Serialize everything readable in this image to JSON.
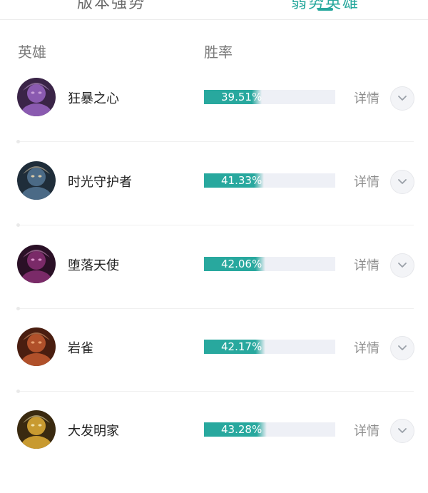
{
  "tabs": [
    {
      "label": "版本强势"
    },
    {
      "label": "弱势英雄"
    }
  ],
  "header": {
    "hero": "英雄",
    "win_rate": "胜率"
  },
  "rows": [
    {
      "name": "狂暴之心",
      "win_rate_text": "39.51%",
      "win_rate": 39.51,
      "detail": "详情",
      "avatar_colors": [
        "#3a2447",
        "#8a5ab0",
        "#c8a0d8"
      ]
    },
    {
      "name": "时光守护者",
      "win_rate_text": "41.33%",
      "win_rate": 41.33,
      "detail": "详情",
      "avatar_colors": [
        "#1f2d3a",
        "#4b6a86",
        "#d8c8a8"
      ]
    },
    {
      "name": "堕落天使",
      "win_rate_text": "42.06%",
      "win_rate": 42.06,
      "detail": "详情",
      "avatar_colors": [
        "#2a1026",
        "#7a2a68",
        "#d890c8"
      ]
    },
    {
      "name": "岩雀",
      "win_rate_text": "42.17%",
      "win_rate": 42.17,
      "detail": "详情",
      "avatar_colors": [
        "#4a1e10",
        "#b0502a",
        "#e8a070"
      ]
    },
    {
      "name": "大发明家",
      "win_rate_text": "43.28%",
      "win_rate": 43.28,
      "detail": "详情",
      "avatar_colors": [
        "#3a2a10",
        "#c89a30",
        "#f0e0a8"
      ]
    }
  ],
  "colors": {
    "accent": "#28a89e",
    "track": "#eef0f6"
  },
  "icons": {
    "expand": "chevron-down-icon"
  }
}
